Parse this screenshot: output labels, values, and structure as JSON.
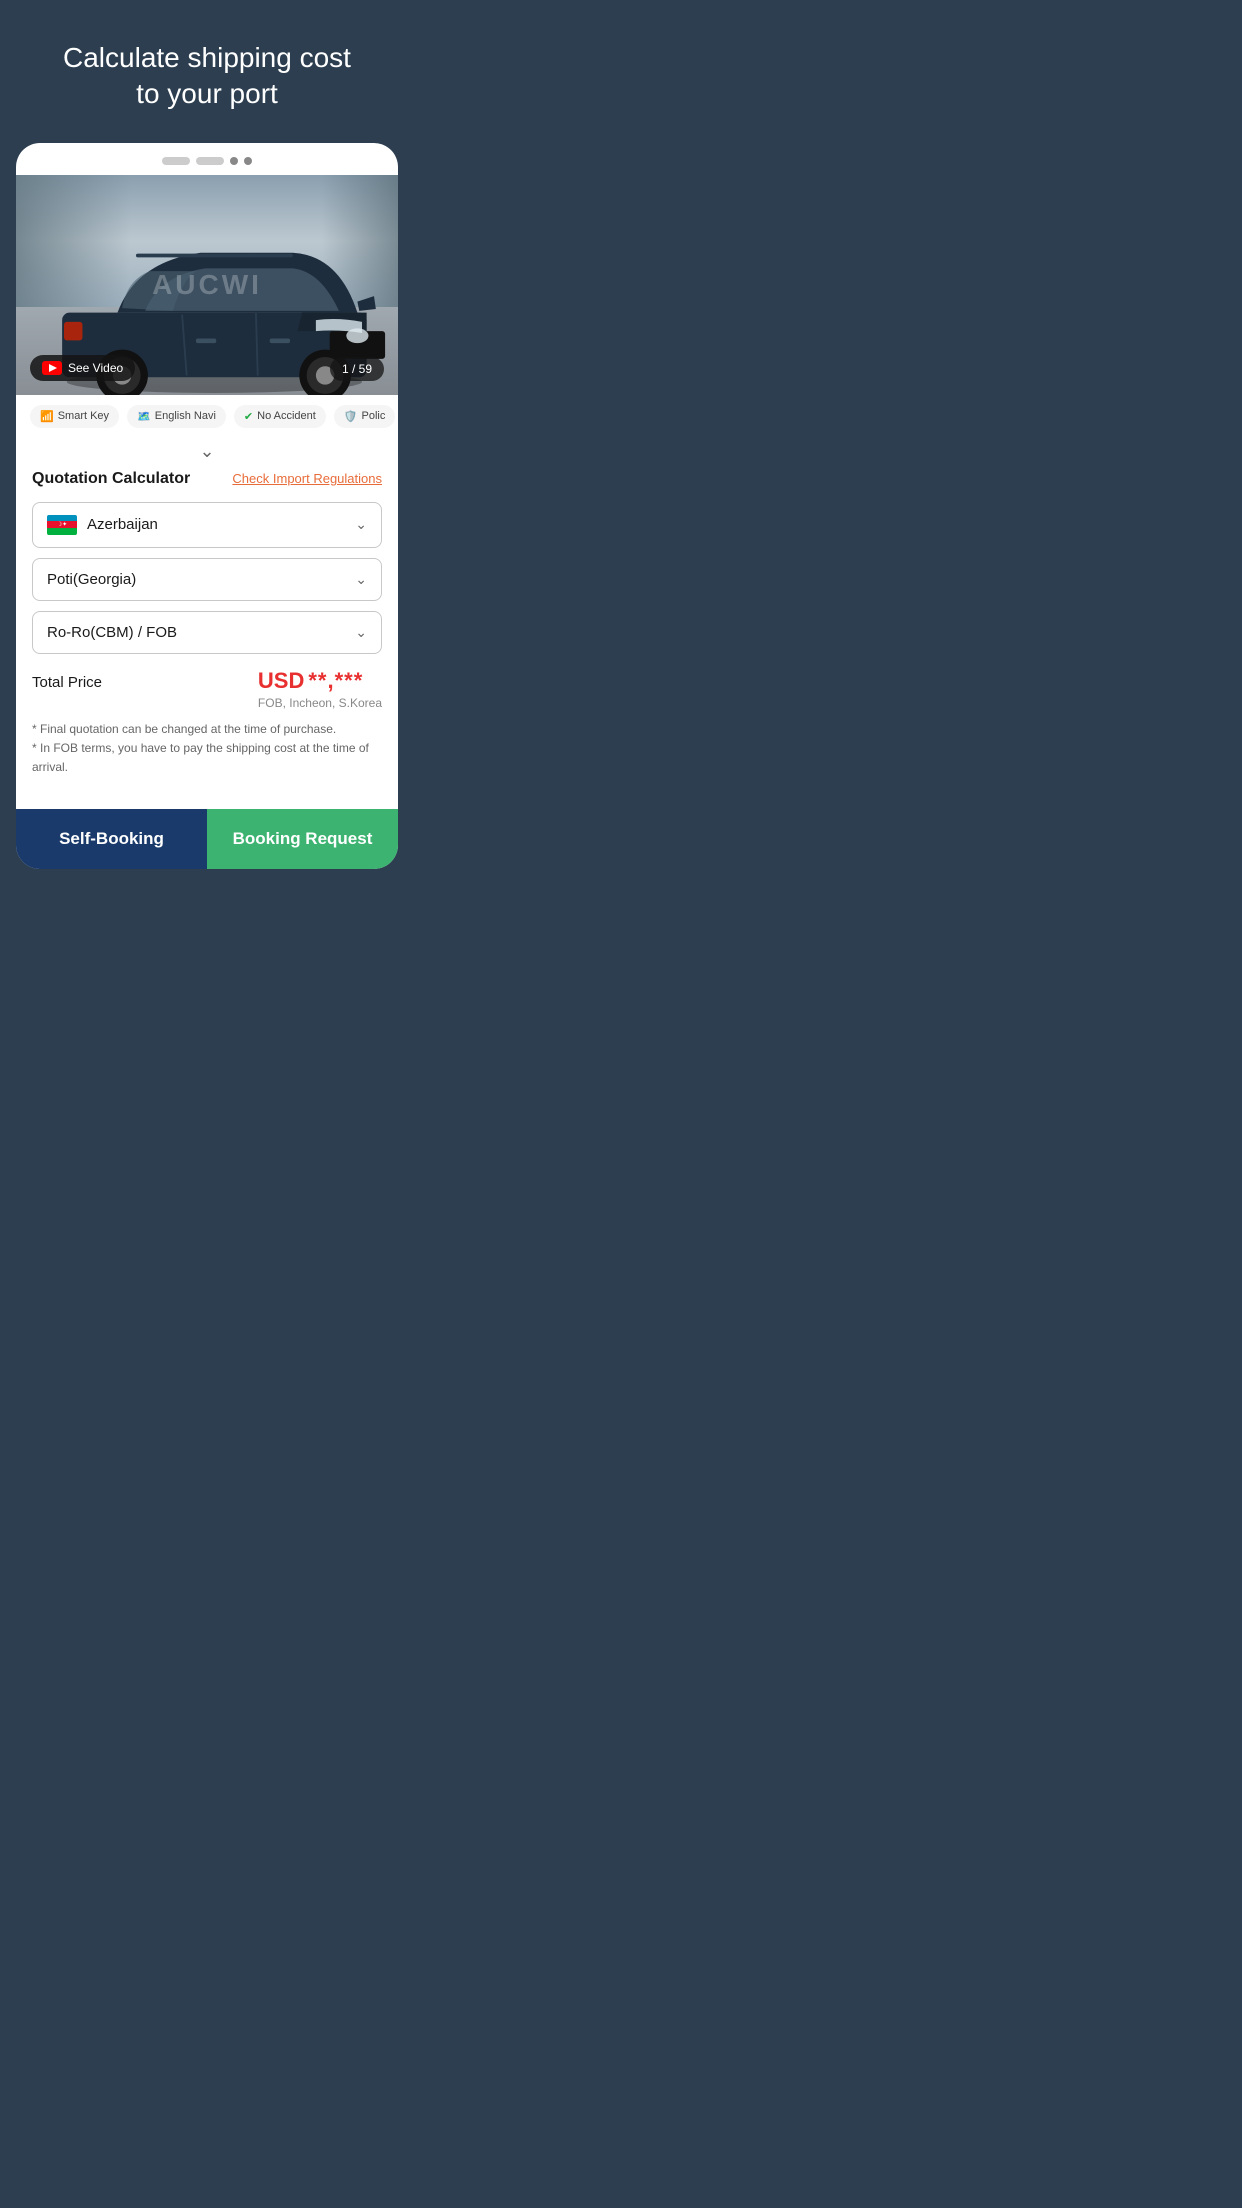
{
  "page": {
    "title_line1": "Calculate shipping cost",
    "title_line2": "to your port",
    "background_color": "#2c3e50"
  },
  "card": {
    "pagination": {
      "dots": [
        "inactive",
        "inactive",
        "active",
        "active"
      ]
    },
    "car_image": {
      "see_video_label": "See Video",
      "counter": "1 / 59",
      "watermark": "AUCWI"
    },
    "features": [
      {
        "icon": "wifi",
        "label": "Smart Key"
      },
      {
        "icon": "nav",
        "label": "English Navi"
      },
      {
        "icon": "check",
        "label": "No Accident"
      },
      {
        "icon": "car",
        "label": "Polic"
      }
    ],
    "quotation": {
      "title": "Quotation Calculator",
      "check_import_label": "Check Import Regulations",
      "country_dropdown": {
        "value": "Azerbaijan",
        "has_flag": true
      },
      "port_dropdown": {
        "value": "Poti(Georgia)"
      },
      "shipping_dropdown": {
        "value": "Ro-Ro(CBM) / FOB"
      },
      "total_price_label": "Total Price",
      "price_currency": "USD",
      "price_value": "**,***",
      "price_sub": "FOB, Incheon, S.Korea",
      "disclaimer_line1": "* Final quotation can be changed at the time of purchase.",
      "disclaimer_line2": "* In FOB terms, you have to pay the shipping cost at the time of arrival."
    },
    "buttons": {
      "self_booking": "Self-Booking",
      "booking_request": "Booking Request"
    }
  }
}
